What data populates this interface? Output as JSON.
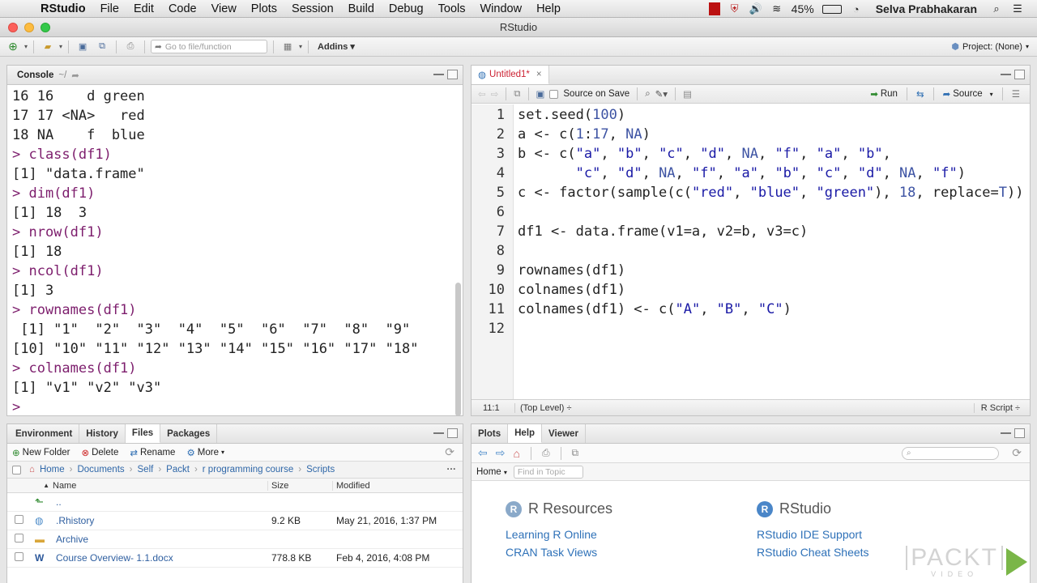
{
  "menubar": {
    "items": [
      "RStudio",
      "File",
      "Edit",
      "Code",
      "View",
      "Plots",
      "Session",
      "Build",
      "Debug",
      "Tools",
      "Window",
      "Help"
    ],
    "battery": "45%",
    "user": "Selva Prabhakaran"
  },
  "window": {
    "title": "RStudio"
  },
  "toolbar": {
    "goto_placeholder": "Go to file/function",
    "addins_label": "Addins",
    "project_label": "Project: (None)"
  },
  "console": {
    "tab_label": "Console",
    "path": "~/",
    "lines": [
      {
        "kind": "out",
        "text": "16 16    d green"
      },
      {
        "kind": "out",
        "text": "17 17 <NA>   red"
      },
      {
        "kind": "out",
        "text": "18 NA    f  blue"
      },
      {
        "kind": "cmd",
        "text": "> class(df1)"
      },
      {
        "kind": "out",
        "text": "[1] \"data.frame\""
      },
      {
        "kind": "cmd",
        "text": "> dim(df1)"
      },
      {
        "kind": "out",
        "text": "[1] 18  3"
      },
      {
        "kind": "cmd",
        "text": "> nrow(df1)"
      },
      {
        "kind": "out",
        "text": "[1] 18"
      },
      {
        "kind": "cmd",
        "text": "> ncol(df1)"
      },
      {
        "kind": "out",
        "text": "[1] 3"
      },
      {
        "kind": "cmd",
        "text": "> rownames(df1)"
      },
      {
        "kind": "out",
        "text": " [1] \"1\"  \"2\"  \"3\"  \"4\"  \"5\"  \"6\"  \"7\"  \"8\"  \"9\""
      },
      {
        "kind": "out",
        "text": "[10] \"10\" \"11\" \"12\" \"13\" \"14\" \"15\" \"16\" \"17\" \"18\""
      },
      {
        "kind": "cmd",
        "text": "> colnames(df1)"
      },
      {
        "kind": "out",
        "text": "[1] \"v1\" \"v2\" \"v3\""
      },
      {
        "kind": "cmd",
        "text": "> "
      }
    ]
  },
  "editor": {
    "tab_label": "Untitled1*",
    "source_on_save": "Source on Save",
    "run_label": "Run",
    "source_label": "Source",
    "code_lines": [
      "set.seed(100)",
      "a <- c(1:17, NA)",
      "b <- c(\"a\", \"b\", \"c\", \"d\", NA, \"f\", \"a\", \"b\",",
      "       \"c\", \"d\", NA, \"f\", \"a\", \"b\", \"c\", \"d\", NA, \"f\")",
      "c <- factor(sample(c(\"red\", \"blue\", \"green\"), 18, replace=T))",
      "",
      "df1 <- data.frame(v1=a, v2=b, v3=c)",
      "",
      "rownames(df1)",
      "colnames(df1)",
      "colnames(df1) <- c(\"A\", \"B\", \"C\")",
      ""
    ],
    "line_numbers": [
      "1",
      "2",
      "3",
      "4",
      "5",
      "6",
      "7",
      "8",
      "9",
      "10",
      "11",
      "12"
    ],
    "status_pos": "11:1",
    "status_scope": "(Top Level) ÷",
    "status_type": "R Script ÷"
  },
  "files_pane": {
    "tabs": [
      "Environment",
      "History",
      "Files",
      "Packages"
    ],
    "active_tab": "Files",
    "actions": {
      "new_folder": "New Folder",
      "delete": "Delete",
      "rename": "Rename",
      "more": "More"
    },
    "breadcrumb": [
      "Home",
      "Documents",
      "Self",
      "Packt",
      "r programming course",
      "Scripts"
    ],
    "columns": {
      "name": "Name",
      "size": "Size",
      "modified": "Modified"
    },
    "rows": [
      {
        "name": "..",
        "size": "",
        "modified": "",
        "icon": "up-arrow-icon"
      },
      {
        "name": ".Rhistory",
        "size": "9.2 KB",
        "modified": "May 21, 2016, 1:37 PM",
        "icon": "file-icon"
      },
      {
        "name": "Archive",
        "size": "",
        "modified": "",
        "icon": "folder-icon"
      },
      {
        "name": "Course Overview- 1.1.docx",
        "size": "778.8 KB",
        "modified": "Feb 4, 2016, 4:08 PM",
        "icon": "word-doc-icon"
      }
    ]
  },
  "help_pane": {
    "tabs": [
      "Plots",
      "Help",
      "Viewer"
    ],
    "active_tab": "Help",
    "home_label": "Home",
    "find_placeholder": "Find in Topic",
    "r_resources": {
      "title": "R Resources",
      "links": [
        "Learning R Online",
        "CRAN Task Views"
      ]
    },
    "rstudio": {
      "title": "RStudio",
      "links": [
        "RStudio IDE Support",
        "RStudio Cheat Sheets"
      ]
    }
  },
  "watermark": {
    "text": "PACKT",
    "sub": "VIDEO"
  },
  "colors": {
    "accent_green": "#3a8a2a",
    "link_blue": "#2e71b8",
    "console_cmd": "#7d1e6d",
    "string_blue": "#1a1aa6"
  }
}
